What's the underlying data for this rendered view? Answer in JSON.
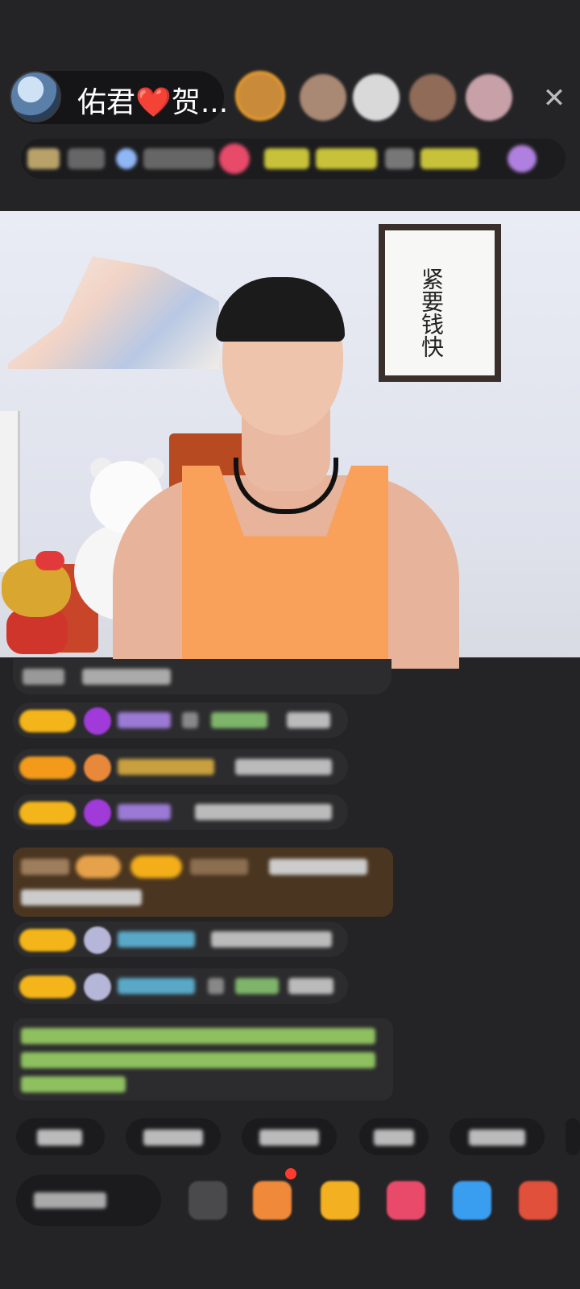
{
  "host": {
    "name": "佑君❤️贺..."
  },
  "close_icon_glyph": "✕",
  "calligraphy": {
    "text": "紧要钱快"
  },
  "colors": {
    "background": "#242426",
    "badge_gold": "#f4b51a",
    "tank_top": "#f9a05a",
    "gift_row": "#4a3520"
  },
  "icons": [
    "host-avatar",
    "close-icon",
    "gift-icon",
    "fan-club-icon",
    "heart-icon",
    "game-icon",
    "more-icon"
  ]
}
